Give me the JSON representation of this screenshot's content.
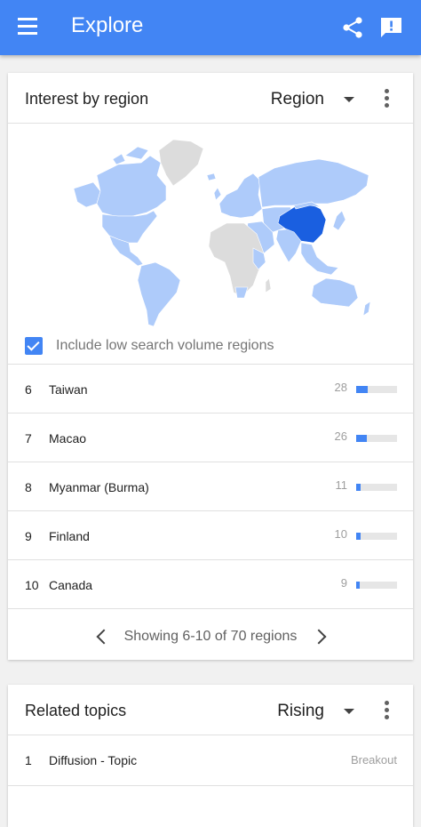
{
  "appbar": {
    "title": "Explore",
    "icons": [
      "menu-icon",
      "share-icon",
      "feedback-icon"
    ],
    "color": "#4285f4"
  },
  "region_card": {
    "title": "Interest by region",
    "dropdown": "Region",
    "include_low_volume": {
      "label": "Include low search volume regions",
      "checked": true
    },
    "map": {
      "highlight_region": "China",
      "highlight_color": "#1a5fe0",
      "base_color": "#aecbfa",
      "no_data_color": "#dcdcdc"
    },
    "rows": [
      {
        "rank": "6",
        "name": "Taiwan",
        "value": "28"
      },
      {
        "rank": "7",
        "name": "Macao",
        "value": "26"
      },
      {
        "rank": "8",
        "name": "Myanmar (Burma)",
        "value": "11"
      },
      {
        "rank": "9",
        "name": "Finland",
        "value": "10"
      },
      {
        "rank": "10",
        "name": "Canada",
        "value": "9"
      }
    ],
    "pager_text": "Showing 6-10 of 70 regions"
  },
  "topics_card": {
    "title": "Related topics",
    "dropdown": "Rising",
    "rows": [
      {
        "rank": "1",
        "name": "Diffusion - Topic",
        "value": "Breakout"
      }
    ]
  }
}
